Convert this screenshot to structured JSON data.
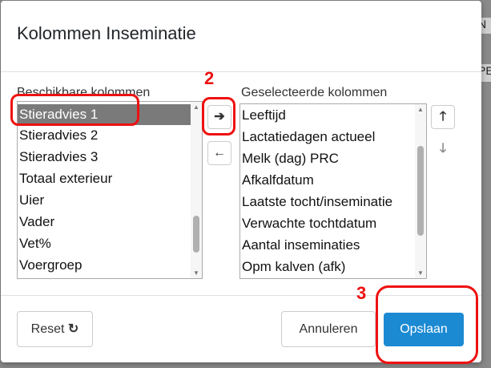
{
  "dialog": {
    "title": "Kolommen Inseminatie",
    "available_label": "Beschikbare kolommen",
    "selected_label": "Geselecteerde kolommen",
    "available_items": [
      "Stieradvies 1",
      "Stieradvies 2",
      "Stieradvies 3",
      "Totaal exterieur",
      "Uier",
      "Vader",
      "Vet%",
      "Voergroep"
    ],
    "selected_items": [
      "Leeftijd",
      "Lactatiedagen actueel",
      "Melk (dag) PRC",
      "Afkalfdatum",
      "Laatste tocht/inseminatie",
      "Verwachte tochtdatum",
      "Aantal inseminaties",
      "Opm kalven (afk)"
    ],
    "selected_available": "Stieradvies 1",
    "reset_label": "Reset",
    "cancel_label": "Annuleren",
    "save_label": "Opslaan"
  },
  "annotations": {
    "step2": "2",
    "step3": "3"
  },
  "background": {
    "peek_1": "N",
    "peek_2": "PE"
  },
  "colors": {
    "accent": "#1b8ad3",
    "annotation": "#ee1111",
    "selection": "#7a7a7a"
  },
  "icons": {
    "move_right": "arrow-right-icon",
    "move_left": "arrow-left-icon",
    "move_up": "arrow-up-icon",
    "move_down": "arrow-down-icon",
    "reset": "refresh-icon"
  }
}
